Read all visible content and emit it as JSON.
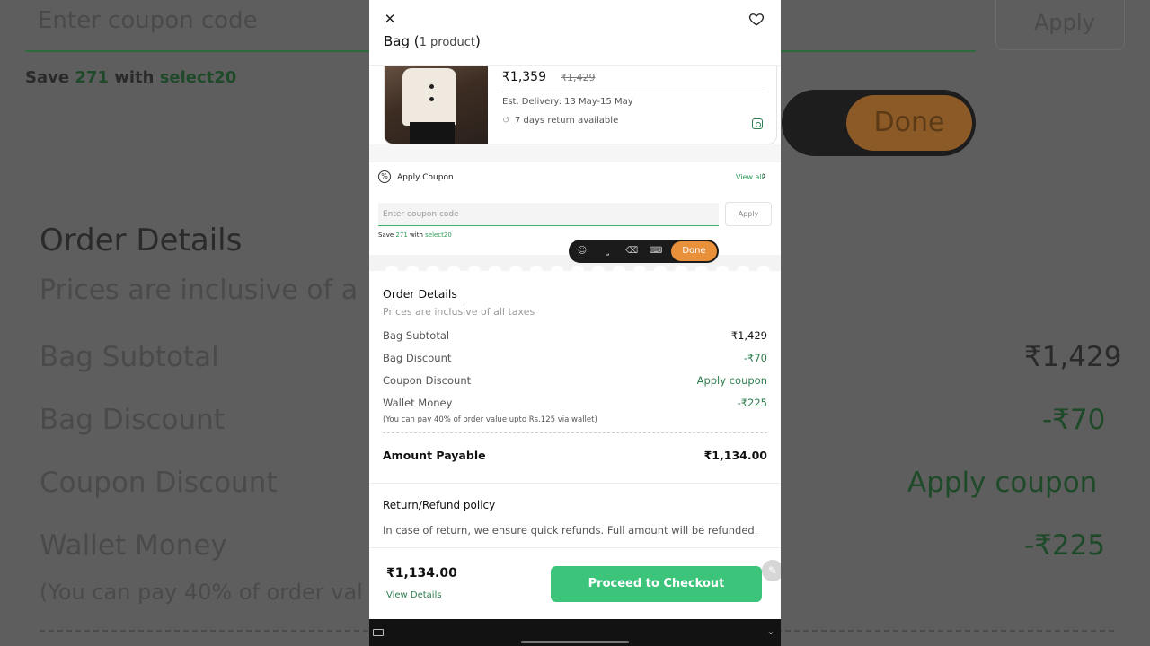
{
  "background": {
    "coupon_placeholder": "Enter coupon code",
    "apply_label": "Apply",
    "save_prefix": "Save",
    "save_amount": "271",
    "save_with": "with",
    "save_code": "select20",
    "done_label": "Done",
    "order_title": "Order Details",
    "order_sub": "Prices are inclusive of a",
    "rows": [
      {
        "label": "Bag Subtotal",
        "value": "₹1,429"
      },
      {
        "label": "Bag Discount",
        "value": "-₹70"
      },
      {
        "label": "Coupon Discount",
        "value": "Apply coupon"
      },
      {
        "label": "Wallet Money",
        "value": "-₹225"
      }
    ],
    "wallet_note": "(You can pay 40% of order val"
  },
  "header": {
    "title": "Bag (",
    "count": "1 product",
    "title_end": ")"
  },
  "product": {
    "price": "₹1,359",
    "mrp": "₹1,429",
    "delivery": "Est. Delivery:  13 May-15 May",
    "returns": "7 days return available"
  },
  "coupon": {
    "label": "Apply Coupon",
    "view_all": "View all",
    "placeholder": "Enter coupon code",
    "apply_label": "Apply",
    "save_prefix": "Save",
    "save_amount": "271",
    "save_with": "with",
    "save_code": "select20"
  },
  "keyboard_bar": {
    "done_label": "Done"
  },
  "order_details": {
    "title": "Order Details",
    "subtitle": "Prices are inclusive of all taxes",
    "rows": [
      {
        "label": "Bag Subtotal",
        "value": "₹1,429"
      },
      {
        "label": "Bag Discount",
        "value": "-₹70"
      },
      {
        "label": "Coupon Discount",
        "value": "Apply coupon"
      },
      {
        "label": "Wallet Money",
        "value": "-₹225"
      }
    ],
    "wallet_note": "(You can pay 40% of order value upto Rs.125 via wallet)",
    "payable_label": "Amount Payable",
    "payable_value": "₹1,134.00"
  },
  "refund": {
    "title": "Return/Refund policy",
    "text": "In case of return, we ensure quick refunds. Full amount will be refunded."
  },
  "footer": {
    "total": "₹1,134.00",
    "view_details": "View Details",
    "checkout_label": "Proceed to Checkout"
  },
  "colors": {
    "accent_green": "#3cc57a",
    "text_green": "#2e7d4f",
    "done_orange": "#e8913a"
  }
}
